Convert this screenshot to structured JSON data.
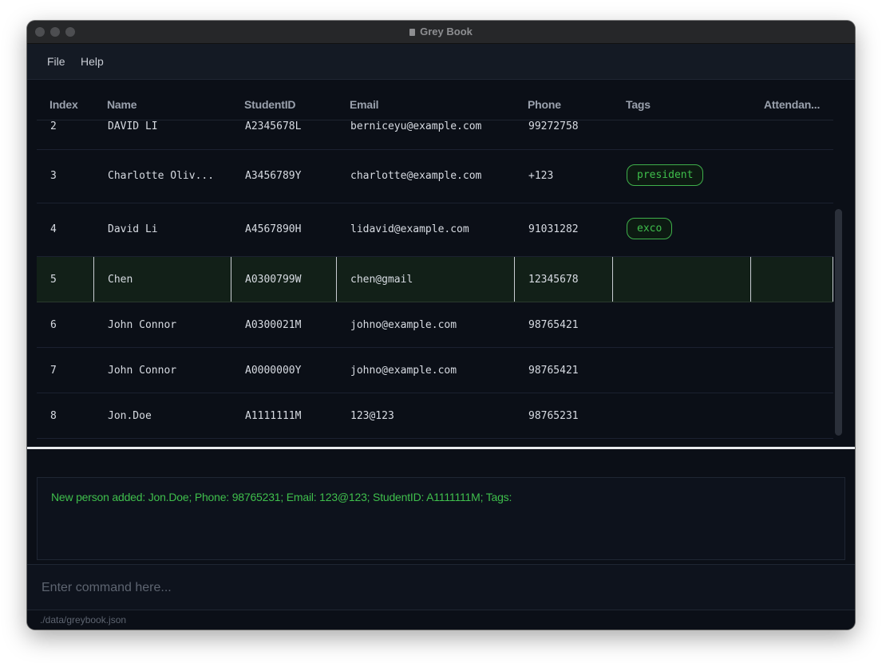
{
  "window": {
    "title": "Grey Book"
  },
  "menu": {
    "file": "File",
    "help": "Help"
  },
  "table": {
    "headers": {
      "index": "Index",
      "name": "Name",
      "student_id": "StudentID",
      "email": "Email",
      "phone": "Phone",
      "tags": "Tags",
      "attendance": "Attendan..."
    },
    "rows": [
      {
        "index": "2",
        "name": "DAVID LI",
        "student_id": "A2345678L",
        "email": "berniceyu@example.com",
        "phone": "99272758",
        "tags": []
      },
      {
        "index": "3",
        "name": "Charlotte Oliv...",
        "student_id": "A3456789Y",
        "email": "charlotte@example.com",
        "phone": "+123",
        "tags": [
          "president"
        ]
      },
      {
        "index": "4",
        "name": "David Li",
        "student_id": "A4567890H",
        "email": "lidavid@example.com",
        "phone": "91031282",
        "tags": [
          "exco"
        ]
      },
      {
        "index": "5",
        "name": "Chen",
        "student_id": "A0300799W",
        "email": "chen@gmail",
        "phone": "12345678",
        "tags": [],
        "selected": true
      },
      {
        "index": "6",
        "name": "John Connor",
        "student_id": "A0300021M",
        "email": "johno@example.com",
        "phone": "98765421",
        "tags": []
      },
      {
        "index": "7",
        "name": "John Connor",
        "student_id": "A0000000Y",
        "email": "johno@example.com",
        "phone": "98765421",
        "tags": []
      },
      {
        "index": "8",
        "name": "Jon.Doe",
        "student_id": "A1111111M",
        "email": "123@123",
        "phone": "98765231",
        "tags": []
      }
    ]
  },
  "result": {
    "message": "New person added: Jon.Doe; Phone: 98765231; Email: 123@123; StudentID: A1111111M; Tags:"
  },
  "command": {
    "placeholder": "Enter command here...",
    "value": ""
  },
  "status": {
    "file_path": "./data/greybook.json"
  },
  "colors": {
    "accent_green": "#3fbf4c",
    "background": "#0b0f17",
    "selected_row": "#122018"
  }
}
